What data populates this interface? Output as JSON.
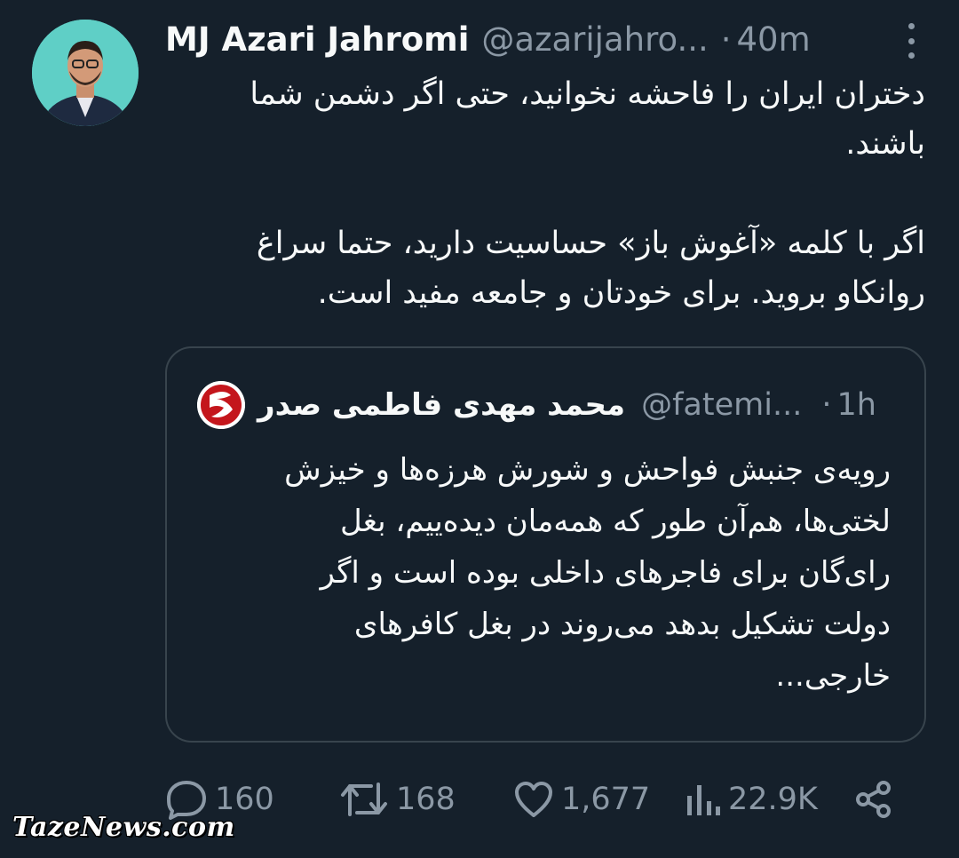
{
  "tweet": {
    "author_name": "MJ Azari Jahromi",
    "author_handle": "@azarijahro...",
    "separator": "·",
    "time": "40m",
    "text": "دختران ایران را فاحشه نخوانید، حتی اگر دشمن شما\nباشند.\n\nاگر با کلمه «آغوش باز» حساسیت دارید، حتما سراغ\nروانکاو بروید. برای خودتان و جامعه مفید است."
  },
  "quoted": {
    "author_name": "محمد مهدی فاطمی صدر",
    "author_handle": "@fatemi...",
    "separator": "·",
    "time": "1h",
    "text": "رویه‌ی جنبش فواحش و شورش هرزه‌ها و خیزش\nلختی‌ها، هم‌آن طور که همه‌مان دیده‌ییم، بغل\nرای‌گان برای فاجرهای داخلی بوده است و اگر\nدولت تشکیل بدهد می‌روند در بغل کافرهای\nخارجی..."
  },
  "actions": {
    "replies": "160",
    "retweets": "168",
    "likes": "1,677",
    "views": "22.9K"
  },
  "icons": {
    "reply": "reply-icon",
    "retweet": "retweet-icon",
    "like": "heart-icon",
    "views": "views-icon",
    "share": "share-icon",
    "more": "more-vertical-icon"
  },
  "watermark": "TazeNews.com",
  "colors": {
    "background": "#15202b",
    "text": "#f7f9f9",
    "muted": "#8b98a5",
    "border": "#38444d"
  }
}
